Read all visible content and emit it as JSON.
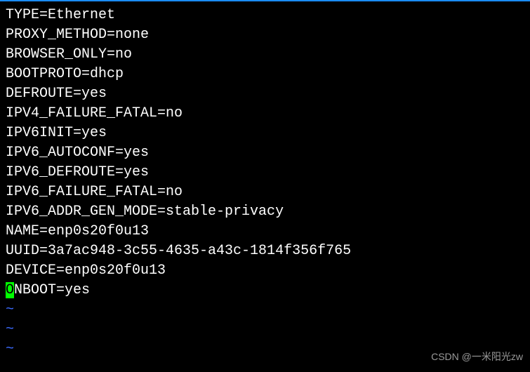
{
  "config": {
    "lines": [
      "TYPE=Ethernet",
      "PROXY_METHOD=none",
      "BROWSER_ONLY=no",
      "BOOTPROTO=dhcp",
      "DEFROUTE=yes",
      "IPV4_FAILURE_FATAL=no",
      "IPV6INIT=yes",
      "IPV6_AUTOCONF=yes",
      "IPV6_DEFROUTE=yes",
      "IPV6_FAILURE_FATAL=no",
      "IPV6_ADDR_GEN_MODE=stable-privacy",
      "NAME=enp0s20f0u13",
      "UUID=3a7ac948-3c55-4635-a43c-1814f356f765",
      "DEVICE=enp0s20f0u13"
    ],
    "cursor_line": {
      "cursor_char": "O",
      "rest": "NBOOT=yes"
    },
    "tilde": "~"
  },
  "watermark": "CSDN @一米阳光zw"
}
